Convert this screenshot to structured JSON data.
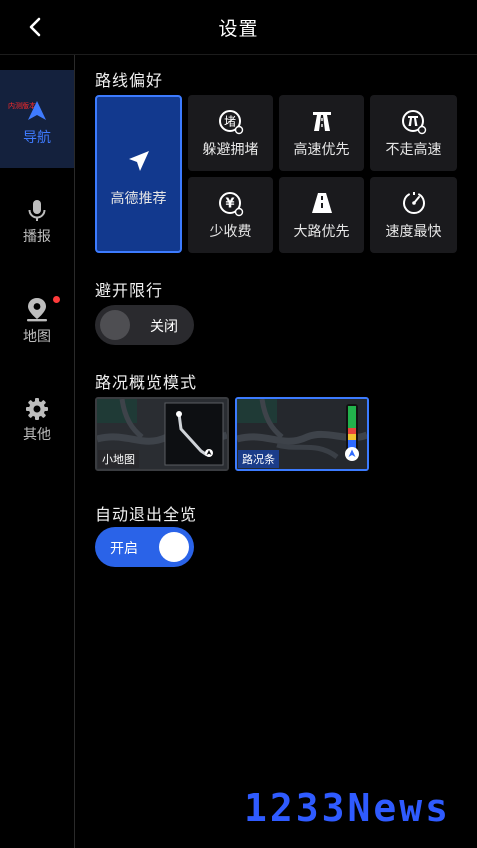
{
  "header": {
    "title": "设置"
  },
  "sidebar": {
    "beta_tag": "内测版本",
    "items": [
      {
        "label": "导航",
        "active": true
      },
      {
        "label": "播报",
        "active": false
      },
      {
        "label": "地图",
        "active": false,
        "has_badge": true
      },
      {
        "label": "其他",
        "active": false
      }
    ]
  },
  "route_pref": {
    "title": "路线偏好",
    "options": [
      {
        "label": "高德推荐",
        "selected": true,
        "icon": "paper-plane-icon"
      },
      {
        "label": "躲避拥堵",
        "selected": false,
        "icon": "avoid-congestion-icon",
        "glyph": "堵"
      },
      {
        "label": "高速优先",
        "selected": false,
        "icon": "highway-icon"
      },
      {
        "label": "不走高速",
        "selected": false,
        "icon": "no-highway-icon"
      },
      {
        "label": "少收费",
        "selected": false,
        "icon": "yuan-icon",
        "glyph": "¥"
      },
      {
        "label": "大路优先",
        "selected": false,
        "icon": "main-road-icon"
      },
      {
        "label": "速度最快",
        "selected": false,
        "icon": "speedometer-icon"
      }
    ]
  },
  "avoid_restriction": {
    "title": "避开限行",
    "toggle_label": "关闭",
    "enabled": false
  },
  "traffic_overview": {
    "title": "路况概览模式",
    "modes": [
      {
        "label": "小地图",
        "selected": false
      },
      {
        "label": "路况条",
        "selected": true
      }
    ]
  },
  "auto_exit": {
    "title": "自动退出全览",
    "toggle_label": "开启",
    "enabled": true
  },
  "watermark": "1233News",
  "colors": {
    "accent": "#3c7bff",
    "selected_tile": "#12398e",
    "tile_bg": "#1a1a1d",
    "badge": "#ff3b3b",
    "toggle_on": "#2a63e8"
  }
}
